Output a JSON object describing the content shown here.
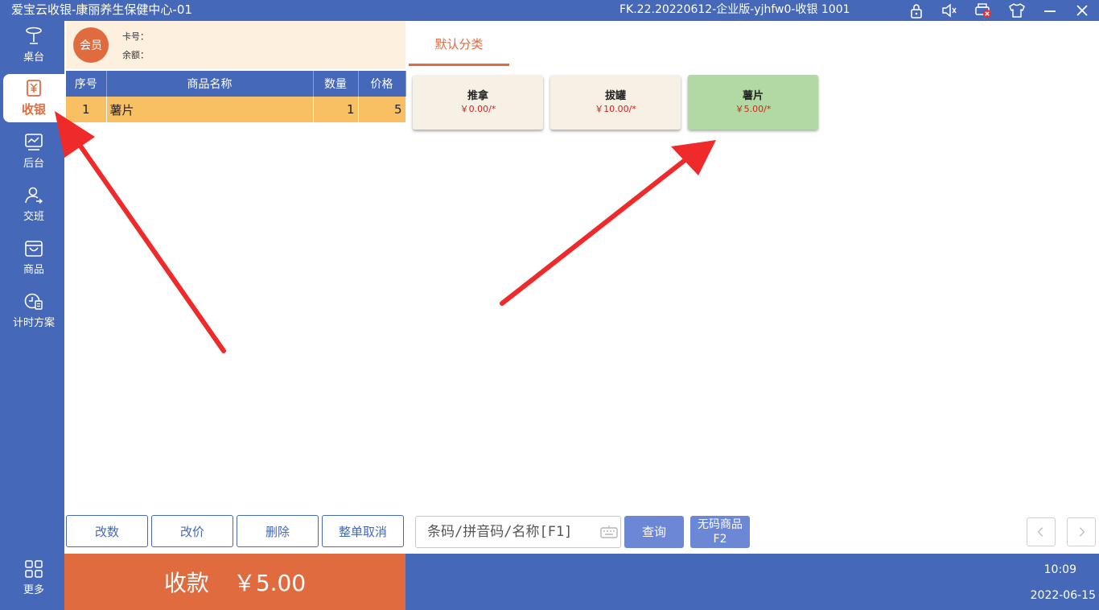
{
  "titlebar": {
    "app_title": "爱宝云收银-康丽养生保健中心-01",
    "version": "FK.22.20220612-企业版-yjhfw0-收银 1001",
    "icons": [
      "lock-icon",
      "speaker-mute-icon",
      "printer-error-icon",
      "shirt-icon",
      "minimize-icon",
      "close-icon"
    ]
  },
  "sidebar": {
    "items": [
      {
        "label": "桌台",
        "icon": "table-icon"
      },
      {
        "label": "收银",
        "icon": "cashier-icon"
      },
      {
        "label": "后台",
        "icon": "backend-chart-icon"
      },
      {
        "label": "交班",
        "icon": "shift-user-icon"
      },
      {
        "label": "商品",
        "icon": "shopping-bag-icon"
      },
      {
        "label": "计时方案",
        "icon": "timer-plan-icon"
      }
    ],
    "more_label": "更多"
  },
  "member": {
    "badge": "会员",
    "card_label": "卡号：",
    "balance_label": "余额："
  },
  "cart": {
    "headers": [
      "序号",
      "商品名称",
      "数量",
      "价格"
    ],
    "rows": [
      {
        "no": "1",
        "name": "薯片",
        "qty": "1",
        "price": "5"
      }
    ]
  },
  "category": {
    "active_tab": "默认分类"
  },
  "products": [
    {
      "name": "推拿",
      "price": "￥0.00/*",
      "bg": "#f7f0e4"
    },
    {
      "name": "拔罐",
      "price": "￥10.00/*",
      "bg": "#f7f0e4"
    },
    {
      "name": "薯片",
      "price": "￥5.00/*",
      "bg": "#b2d8a4"
    }
  ],
  "actions": {
    "change_qty": "改数",
    "change_price": "改价",
    "delete": "删除",
    "cancel_all": "整单取消"
  },
  "search": {
    "placeholder": "条码/拼音码/名称[F1]",
    "query_label": "查询",
    "no_code_label": "无码商品",
    "no_code_key": "F2"
  },
  "payment": {
    "label": "收款",
    "amount": "￥5.00"
  },
  "clock": {
    "time": "10:09",
    "date": "2022-06-15"
  },
  "colors": {
    "primary_blue": "#4668b8",
    "accent_orange": "#e06b3e",
    "row_highlight": "#f8c062",
    "arrow_red": "#ee2a2a"
  }
}
